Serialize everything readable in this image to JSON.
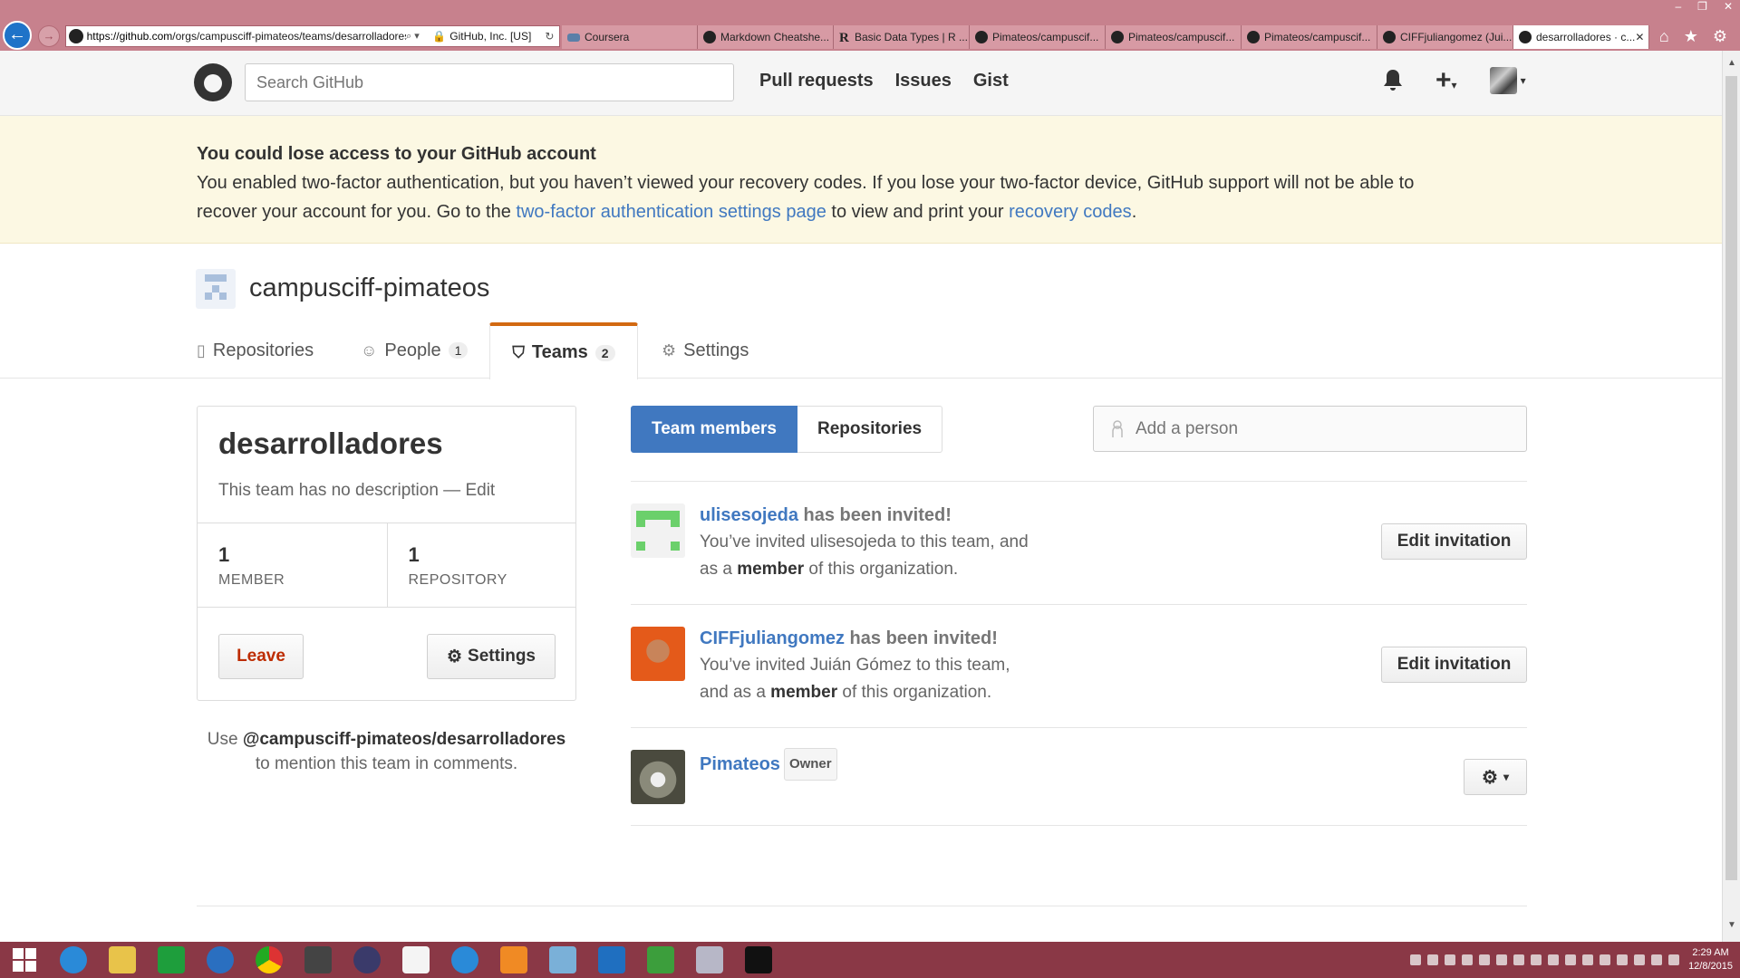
{
  "browser": {
    "url_host": "https://github.com",
    "url_path": "/orgs/campusciff-pimateos/teams/desarrolladores",
    "cert": "GitHub, Inc. [US]",
    "tabs": [
      {
        "label": "Coursera",
        "icon": "coursera-icon",
        "active": false
      },
      {
        "label": "Markdown Cheatshe...",
        "icon": "github-icon",
        "active": false
      },
      {
        "label": "Basic Data Types | R ...",
        "icon": "r-icon",
        "active": false
      },
      {
        "label": "Pimateos/campuscif...",
        "icon": "github-icon",
        "active": false
      },
      {
        "label": "Pimateos/campuscif...",
        "icon": "github-icon",
        "active": false
      },
      {
        "label": "Pimateos/campuscif...",
        "icon": "github-icon",
        "active": false
      },
      {
        "label": "CIFFjuliangomez (Jui...",
        "icon": "github-icon",
        "active": false
      },
      {
        "label": "desarrolladores · c...",
        "icon": "github-icon",
        "active": true
      }
    ]
  },
  "header": {
    "search_placeholder": "Search GitHub",
    "nav": [
      "Pull requests",
      "Issues",
      "Gist"
    ],
    "plus": "+"
  },
  "flash": {
    "title": "You could lose access to your GitHub account",
    "line1": "You enabled two-factor authentication, but you haven’t viewed your recovery codes. If you lose your two-factor device, GitHub support will not be able to",
    "line2_pre": "recover your account for you. Go to the ",
    "link1": "two-factor authentication settings page",
    "line2_mid": " to view and print your ",
    "link2": "recovery codes",
    "line2_end": "."
  },
  "org": {
    "name": "campusciff-pimateos",
    "tabs": [
      {
        "label": "Repositories",
        "count": ""
      },
      {
        "label": "People",
        "count": "1"
      },
      {
        "label": "Teams",
        "count": "2"
      },
      {
        "label": "Settings",
        "count": ""
      }
    ]
  },
  "team": {
    "name": "desarrolladores",
    "desc": "This team has no description — ",
    "desc_edit": "Edit",
    "members_count": "1",
    "members_label": "MEMBER",
    "repos_count": "1",
    "repos_label": "REPOSITORY",
    "leave_label": "Leave",
    "settings_label": "Settings",
    "mention_pre": "Use ",
    "mention_handle": "@campusciff-pimateos/desarrolladores",
    "mention_post": "to mention this team in comments."
  },
  "main": {
    "seg_members": "Team members",
    "seg_repos": "Repositories",
    "add_placeholder": "Add a person",
    "rows": [
      {
        "login": "ulisesojeda",
        "status": " has been invited!",
        "line1": "You’ve invited ulisesojeda to this team, and",
        "line2_pre": "as a ",
        "role": "member",
        "line2_post": " of this organization.",
        "action": "Edit invitation"
      },
      {
        "login": "CIFFjuliangomez",
        "status": " has been invited!",
        "line1": "You’ve invited Juián Gómez to this team,",
        "line2_pre": "and as a ",
        "role": "member",
        "line2_post": " of this organization.",
        "action": "Edit invitation"
      },
      {
        "login": "Pimateos",
        "badge": "Owner"
      }
    ]
  },
  "taskbar": {
    "time": "2:29 AM",
    "date": "12/8/2015"
  }
}
